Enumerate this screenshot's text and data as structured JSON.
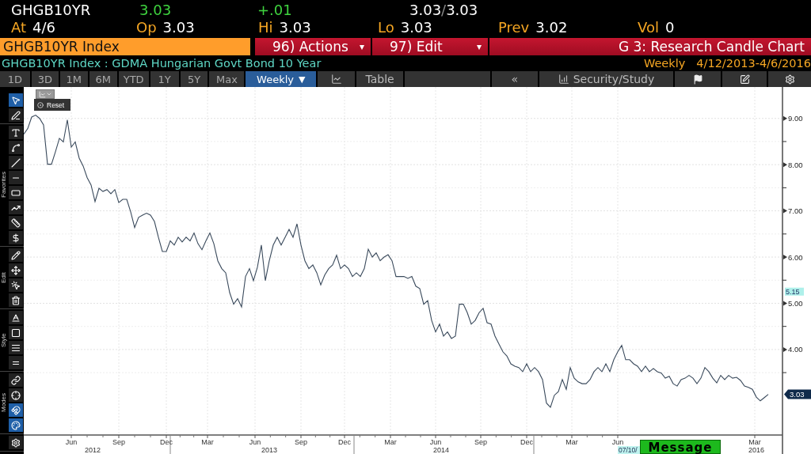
{
  "quote": {
    "ticker": "GHGB10YR",
    "last": "3.03",
    "change": "+.01",
    "bid": "3.03",
    "separator": "/",
    "ask": "3.03"
  },
  "stats": [
    {
      "label": "At",
      "value": "4/6"
    },
    {
      "label": "Op",
      "value": "3.03"
    },
    {
      "label": "Hi",
      "value": "3.03"
    },
    {
      "label": "Lo",
      "value": "3.03"
    },
    {
      "label": "Prev",
      "value": "3.02"
    },
    {
      "label": "Vol",
      "value": "0"
    }
  ],
  "command_bar": {
    "security": "GHGB10YR Index",
    "menus": [
      {
        "label": "96) Actions",
        "caret": "▾"
      },
      {
        "label": "97) Edit",
        "caret": "▾"
      }
    ],
    "title": "G 3: Research Candle Chart"
  },
  "info_bar": {
    "description": "GHGB10YR Index : GDMA Hungarian Govt Bond 10 Year",
    "period": "Weekly",
    "date_range": "4/12/2013-4/6/2016"
  },
  "range_tabs": [
    {
      "label": "1D",
      "selected": false,
      "kind": "tab"
    },
    {
      "label": "3D",
      "selected": false,
      "kind": "tab"
    },
    {
      "label": "1M",
      "selected": false,
      "kind": "tab"
    },
    {
      "label": "6M",
      "selected": false,
      "kind": "tab"
    },
    {
      "label": "YTD",
      "selected": false,
      "kind": "tab"
    },
    {
      "label": "1Y",
      "selected": false,
      "kind": "tab"
    },
    {
      "label": "5Y",
      "selected": false,
      "kind": "tab"
    },
    {
      "label": "Max",
      "selected": false,
      "kind": "tab"
    },
    {
      "label": "Weekly",
      "caret": "▼",
      "selected": true,
      "kind": "dropdown"
    }
  ],
  "toolbar": {
    "table": "Table",
    "collapse": "«",
    "security_study": "Security/Study"
  },
  "tool_groups": [
    {
      "tools": [
        {
          "selected": true
        },
        {
          "selected": false
        }
      ]
    },
    {
      "label": "Favorites",
      "tools": [
        {
          "selected": false
        },
        {
          "selected": false
        },
        {
          "selected": false
        },
        {
          "selected": false
        },
        {
          "selected": false
        },
        {
          "selected": false
        },
        {
          "selected": false
        },
        {
          "selected": false
        }
      ]
    },
    {
      "label": "Edit",
      "tools": [
        {
          "selected": false
        },
        {
          "selected": false
        },
        {
          "selected": false
        },
        {
          "selected": false
        }
      ]
    },
    {
      "label": "Style",
      "tools": [
        {
          "selected": false
        },
        {
          "selected": false
        },
        {
          "selected": false
        },
        {
          "selected": false
        }
      ]
    },
    {
      "label": "Modes",
      "tools": [
        {
          "selected": false
        },
        {
          "selected": false
        },
        {
          "selected": true
        },
        {
          "selected": true
        }
      ]
    },
    {
      "tools": [
        {
          "selected": false
        }
      ]
    }
  ],
  "chart_menu": {
    "option": "Reset"
  },
  "chart": {
    "chart_data": {
      "type": "line",
      "ylim": [
        2.15,
        9.68
      ],
      "grid": true,
      "yticks": [
        {
          "value": 4,
          "label": "4.00"
        },
        {
          "value": 5,
          "label": "5.00"
        },
        {
          "value": 6,
          "label": "6.00"
        },
        {
          "value": 7,
          "label": "7.00"
        },
        {
          "value": 8,
          "label": "8.00"
        },
        {
          "value": 9,
          "label": "9.00"
        }
      ],
      "series": [
        {
          "color": "#3a4a5c",
          "values": [
            8.66,
            8.78,
            9.03,
            9.07,
            9.0,
            8.86,
            8.01,
            8.01,
            8.28,
            8.57,
            8.49,
            8.97,
            8.38,
            8.49,
            8.14,
            7.97,
            7.72,
            7.56,
            7.2,
            7.49,
            7.42,
            7.46,
            7.37,
            7.46,
            7.18,
            7.25,
            7.25,
            6.98,
            6.64,
            6.86,
            6.91,
            6.95,
            6.91,
            6.77,
            6.43,
            6.12,
            6.12,
            6.35,
            6.26,
            6.43,
            6.33,
            6.43,
            6.35,
            6.52,
            6.29,
            6.16,
            6.35,
            6.52,
            6.29,
            5.92,
            5.75,
            5.66,
            5.23,
            4.98,
            5.1,
            4.92,
            5.58,
            5.75,
            5.49,
            5.78,
            6.26,
            5.49,
            5.92,
            6.26,
            6.43,
            6.26,
            6.43,
            6.6,
            6.43,
            6.72,
            6.26,
            5.92,
            5.75,
            5.83,
            5.66,
            5.4,
            5.61,
            5.75,
            5.83,
            6.04,
            5.75,
            5.83,
            5.75,
            5.58,
            5.66,
            5.58,
            5.75,
            6.17,
            6.0,
            6.09,
            5.92,
            6.0,
            6.05,
            5.92,
            5.58,
            5.58,
            5.58,
            5.54,
            5.58,
            5.37,
            5.32,
            4.98,
            5.06,
            4.63,
            4.38,
            4.55,
            4.29,
            4.38,
            4.24,
            4.29,
            4.98,
            4.98,
            4.8,
            4.55,
            4.63,
            4.8,
            4.89,
            4.58,
            4.55,
            4.29,
            4.12,
            3.95,
            3.86,
            3.69,
            3.64,
            3.61,
            3.52,
            3.69,
            3.52,
            3.61,
            3.52,
            3.35,
            2.84,
            2.75,
            3.01,
            3.09,
            3.35,
            3.14,
            3.61,
            3.38,
            3.3,
            3.26,
            3.26,
            3.35,
            3.52,
            3.61,
            3.52,
            3.69,
            3.52,
            3.78,
            3.95,
            4.09,
            3.78,
            3.78,
            3.69,
            3.64,
            3.52,
            3.64,
            3.52,
            3.59,
            3.52,
            3.49,
            3.38,
            3.42,
            3.26,
            3.21,
            3.35,
            3.38,
            3.44,
            3.38,
            3.26,
            3.38,
            3.61,
            3.52,
            3.38,
            3.28,
            3.44,
            3.35,
            3.44,
            3.38,
            3.4,
            3.33,
            3.21,
            3.18,
            3.14,
            2.97,
            2.89,
            2.96,
            3.03
          ]
        }
      ]
    },
    "months": [
      "Jun",
      "Sep",
      "Dec",
      "Mar",
      "Jun",
      "Sep",
      "Dec",
      "Mar",
      "Jun",
      "Sep",
      "Dec",
      "Mar",
      "Jun",
      "Mar"
    ],
    "years": [
      "2012",
      "2013",
      "2014",
      "2016"
    ],
    "tags": [
      {
        "kind": "study",
        "text": "5.15"
      },
      {
        "kind": "last",
        "text": "3.03"
      },
      {
        "kind": "date",
        "text": "07/10/"
      }
    ]
  },
  "message_button": "Message"
}
